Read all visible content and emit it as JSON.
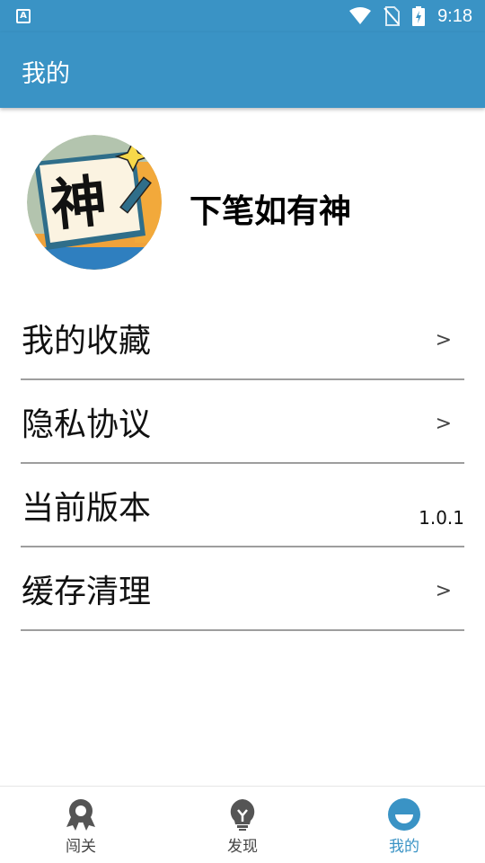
{
  "status_bar": {
    "notification_icon": "app-notification-icon",
    "notification_letter": "A",
    "time": "9:18"
  },
  "app_bar": {
    "title": "我的"
  },
  "profile": {
    "name": "下笔如有神",
    "avatar_glyph": "神"
  },
  "menu": {
    "items": [
      {
        "label": "我的收藏",
        "arrow": ">"
      },
      {
        "label": "隐私协议",
        "arrow": ">"
      },
      {
        "label": "当前版本",
        "value": "1.0.1"
      },
      {
        "label": "缓存清理",
        "arrow": ">"
      }
    ]
  },
  "bottom_nav": {
    "items": [
      {
        "label": "闯关",
        "icon": "medal-icon",
        "active": false
      },
      {
        "label": "发现",
        "icon": "lightbulb-icon",
        "active": false
      },
      {
        "label": "我的",
        "icon": "smiley-icon",
        "active": true
      }
    ]
  },
  "colors": {
    "accent": "#3a93c5",
    "divider": "#9e9e9e",
    "inactive_icon": "#555555"
  }
}
